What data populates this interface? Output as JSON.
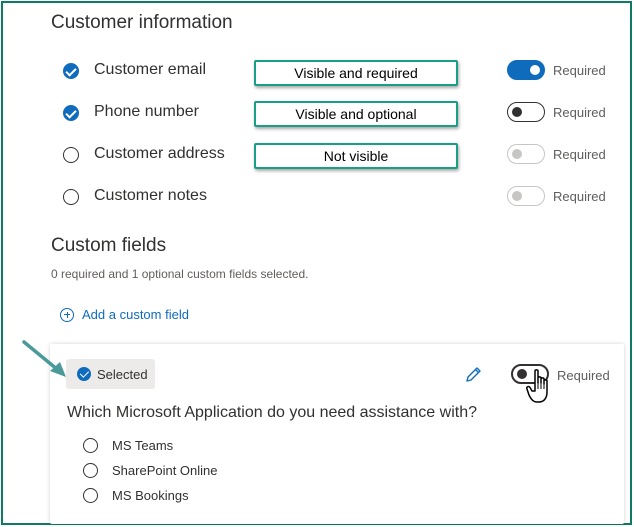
{
  "customer_info": {
    "title": "Customer information",
    "fields": [
      {
        "label": "Customer email",
        "checked": true,
        "toggle_state": "on",
        "required_label": "Required",
        "callout": "Visible and required"
      },
      {
        "label": "Phone number",
        "checked": true,
        "toggle_state": "off",
        "required_label": "Required",
        "callout": "Visible and optional"
      },
      {
        "label": "Customer address",
        "checked": false,
        "toggle_state": "disabled",
        "required_label": "Required",
        "callout": "Not visible"
      },
      {
        "label": "Customer notes",
        "checked": false,
        "toggle_state": "disabled",
        "required_label": "Required"
      }
    ]
  },
  "custom_fields": {
    "title": "Custom fields",
    "summary": "0 required and 1 optional custom fields selected.",
    "add_label": "Add a custom field",
    "card": {
      "selected_label": "Selected",
      "required_label": "Required",
      "question": "Which Microsoft Application do you need assistance with?",
      "options": [
        "MS Teams",
        "SharePoint Online",
        "MS Bookings"
      ]
    }
  },
  "colors": {
    "accent": "#0f6cbd",
    "frame": "#0e7b62",
    "callout_border": "#17a085",
    "arrow": "#4a9a9a"
  },
  "icons": [
    "check-circle-icon",
    "radio-empty-icon",
    "plus-circle-icon",
    "pencil-icon",
    "hand-cursor-icon",
    "arrow-icon"
  ]
}
